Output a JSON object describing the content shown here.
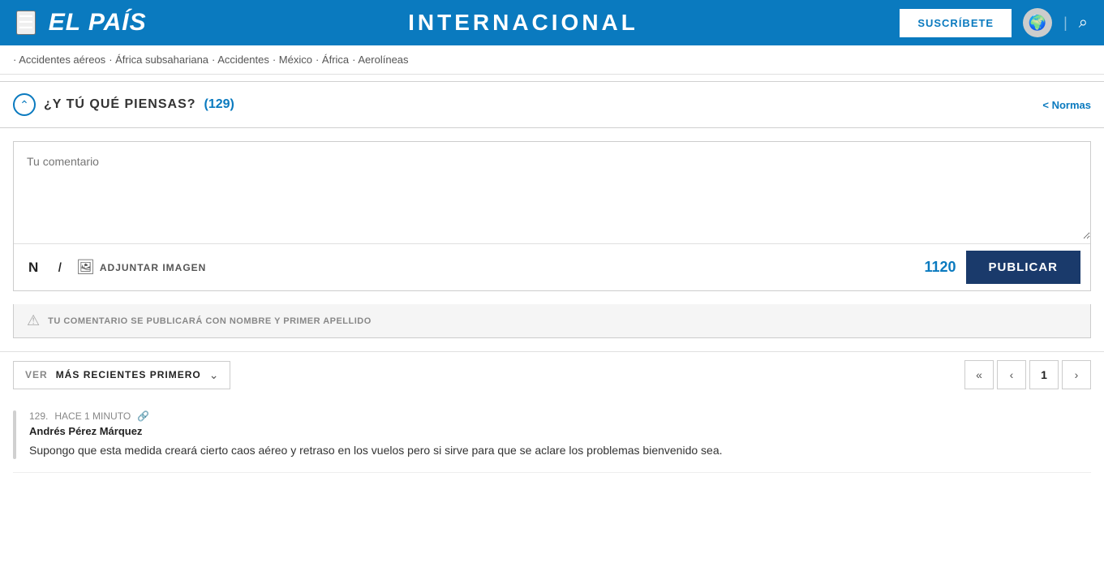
{
  "header": {
    "logo": "EL PAÍS",
    "section": "INTERNACIONAL",
    "subscribe_label": "SUSCRÍBETE",
    "hamburger_symbol": "☰",
    "search_symbol": "🔍"
  },
  "tags": [
    "· Accidentes aéreos",
    "· África subsahariana",
    "· Accidentes",
    "· México",
    "· África",
    "· Aerolíneas"
  ],
  "comments_section": {
    "title": "¿Y TÚ QUÉ PIENSAS?",
    "count": "(129)",
    "normas_link": "< Normas",
    "textarea_placeholder": "Tu comentario",
    "bold_symbol": "N",
    "italic_symbol": "I",
    "attach_label": "ADJUNTAR IMAGEN",
    "char_count": "1120",
    "publish_label": "PUBLICAR",
    "info_text": "TU COMENTARIO SE PUBLICARÁ CON NOMBRE Y PRIMER APELLIDO"
  },
  "sort": {
    "ver_label": "VER",
    "sort_value": "MÁS RECIENTES PRIMERO"
  },
  "pagination": {
    "first_symbol": "«",
    "prev_symbol": "‹",
    "current_page": "1",
    "next_symbol": "›"
  },
  "comments": [
    {
      "number": "129.",
      "time": "HACE 1 MINUTO",
      "author": "Andrés Pérez Márquez",
      "text": "Supongo que esta medida creará cierto caos aéreo y retraso en los vuelos pero si sirve para que se aclare los problemas bienvenido sea."
    }
  ]
}
